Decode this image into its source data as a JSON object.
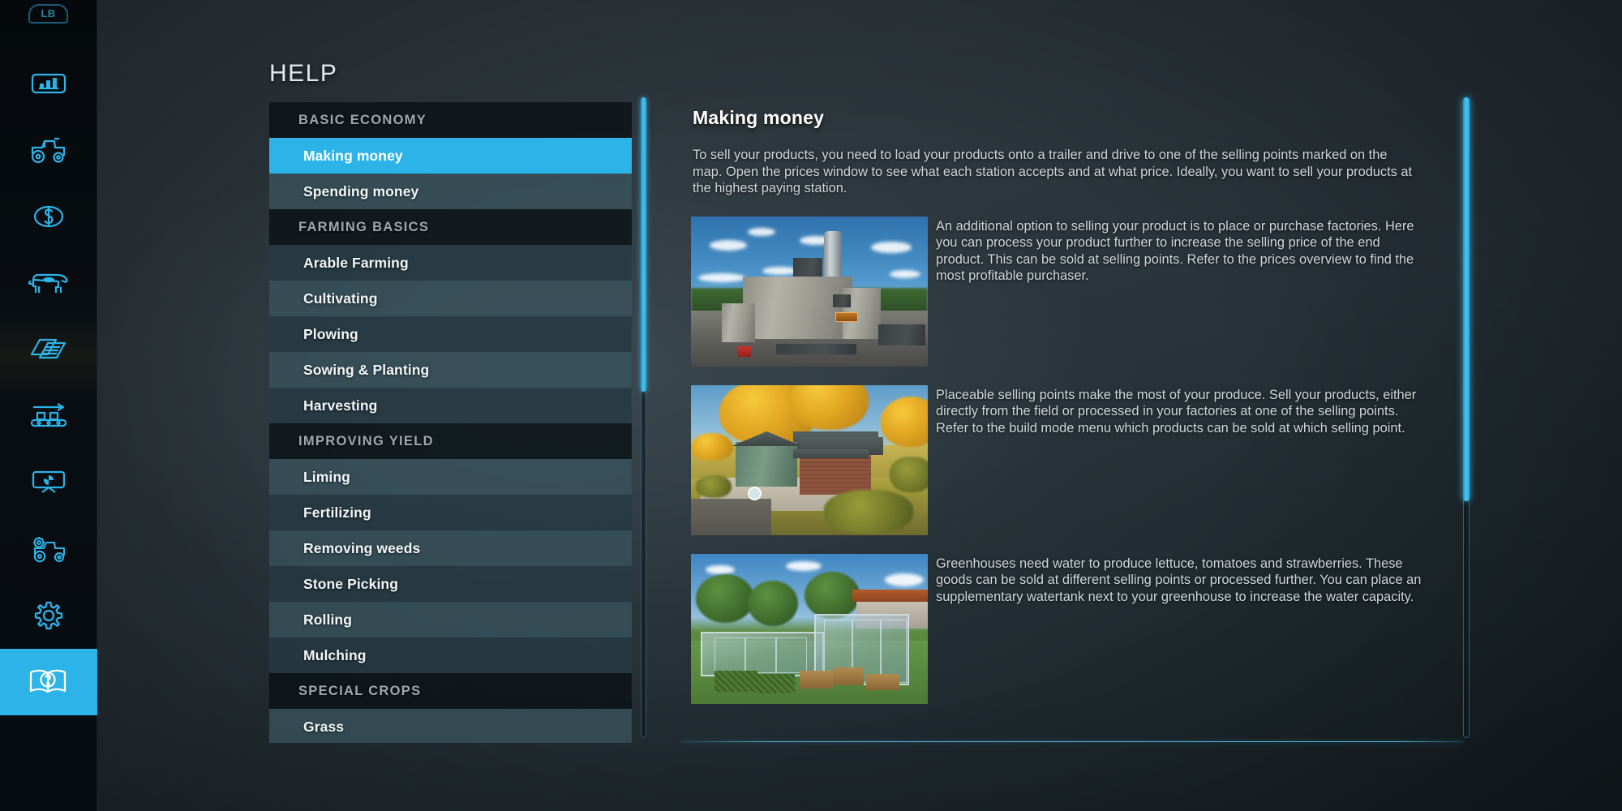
{
  "hud": {
    "shoulder_hint": "LB"
  },
  "rail": {
    "items": [
      {
        "name": "statistics-icon",
        "label": "Statistics"
      },
      {
        "name": "vehicles-icon",
        "label": "Vehicles"
      },
      {
        "name": "finances-icon",
        "label": "Finances"
      },
      {
        "name": "animals-icon",
        "label": "Animals"
      },
      {
        "name": "contracts-icon",
        "label": "Contracts"
      },
      {
        "name": "production-icon",
        "label": "Production"
      },
      {
        "name": "prices-icon",
        "label": "Prices"
      },
      {
        "name": "vehicle-config-icon",
        "label": "Vehicle Configuration"
      },
      {
        "name": "settings-icon",
        "label": "Settings"
      },
      {
        "name": "help-icon",
        "label": "Help"
      }
    ],
    "active_index": 9
  },
  "page": {
    "title": "HELP"
  },
  "menu": {
    "rows": [
      {
        "type": "header",
        "label": "BASIC ECONOMY"
      },
      {
        "type": "item",
        "label": "Making money",
        "selected": true
      },
      {
        "type": "item",
        "label": "Spending money",
        "selected": false
      },
      {
        "type": "header",
        "label": "FARMING BASICS"
      },
      {
        "type": "item",
        "label": "Arable Farming",
        "selected": false
      },
      {
        "type": "item",
        "label": "Cultivating",
        "selected": false
      },
      {
        "type": "item",
        "label": "Plowing",
        "selected": false
      },
      {
        "type": "item",
        "label": "Sowing & Planting",
        "selected": false
      },
      {
        "type": "item",
        "label": "Harvesting",
        "selected": false
      },
      {
        "type": "header",
        "label": "IMPROVING YIELD"
      },
      {
        "type": "item",
        "label": "Liming",
        "selected": false
      },
      {
        "type": "item",
        "label": "Fertilizing",
        "selected": false
      },
      {
        "type": "item",
        "label": "Removing weeds",
        "selected": false
      },
      {
        "type": "item",
        "label": "Stone Picking",
        "selected": false
      },
      {
        "type": "item",
        "label": "Rolling",
        "selected": false
      },
      {
        "type": "item",
        "label": "Mulching",
        "selected": false
      },
      {
        "type": "header",
        "label": "SPECIAL CROPS"
      },
      {
        "type": "item",
        "label": "Grass",
        "selected": false
      }
    ]
  },
  "article": {
    "title": "Making money",
    "intro": "To sell your products, you need to load your products onto a trailer and drive to one of the selling points marked on the map. Open the prices window to see what each station accepts and at what price. Ideally, you want to sell your products at the highest paying station.",
    "blocks": [
      {
        "image_name": "factory-screenshot",
        "text": "An additional option to selling your product is to place or purchase factories. Here you can process your product further to increase the selling price of the end product. This can be sold at selling points. Refer to the prices overview to find the most profitable purchaser."
      },
      {
        "image_name": "selling-point-screenshot",
        "text": "Placeable selling points make the most of your produce. Sell your products, either directly from the field or processed in your factories at one of the selling points. Refer to the build mode menu which products can be sold at which selling point."
      },
      {
        "image_name": "greenhouse-screenshot",
        "text": "Greenhouses need water to produce lettuce, tomatoes and strawberries. These goods can be sold at different selling points or processed further. You can place an supplementary watertank next to your greenhouse to increase the water capacity."
      }
    ]
  },
  "scrollbars": {
    "menu_thumb_percent": 46,
    "content_thumb_percent": 63
  },
  "colors": {
    "accent": "#2cb3e8",
    "background": "#2c363c",
    "rail": "#080d11",
    "row_odd": "#263a44",
    "row_even": "#38525c",
    "header_row": "#0a1217",
    "text_primary": "#f2f6f8",
    "text_muted": "#9fa9ae",
    "body_text": "#ced7dc"
  }
}
